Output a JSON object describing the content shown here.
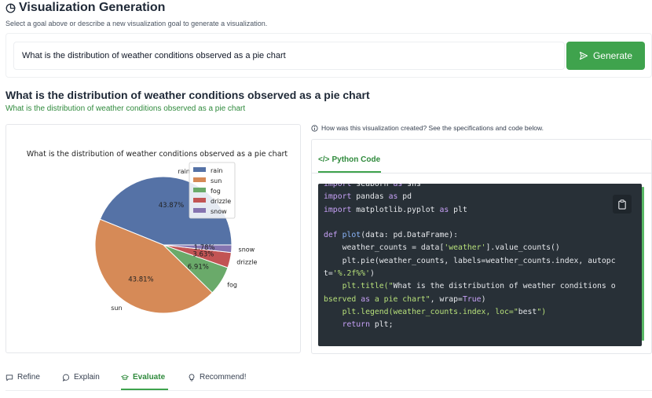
{
  "header": {
    "title": "Visualization Generation",
    "subtitle": "Select a goal above or describe a new visualization goal to generate a visualization."
  },
  "goal": {
    "input_value": "What is the distribution of weather conditions observed as a pie chart",
    "generate_label": "Generate"
  },
  "visualization": {
    "title": "What is the distribution of weather conditions observed as a pie chart",
    "subtitle": "What is the distribution of weather conditions observed as a pie chart",
    "info_text": "How was this visualization created? See the specifications and code below."
  },
  "code_panel": {
    "tab_label": "Python Code",
    "lines": [
      "import seaborn as sns",
      "import pandas as pd",
      "import matplotlib.pyplot as plt",
      "",
      "def plot(data: pd.DataFrame):",
      "    weather_counts = data['weather'].value_counts()",
      "    plt.pie(weather_counts, labels=weather_counts.index, autopc",
      "t='%.2f%%')",
      "    plt.title(\"What is the distribution of weather conditions o",
      "bserved as a pie chart\", wrap=True)",
      "    plt.legend(weather_counts.index, loc=\"best\")",
      "    return plt;"
    ]
  },
  "bottom_tabs": [
    {
      "label": "Refine",
      "icon": "chat-icon",
      "active": false
    },
    {
      "label": "Explain",
      "icon": "speech-bubble-icon",
      "active": false
    },
    {
      "label": "Evaluate",
      "icon": "graduation-cap-icon",
      "active": true
    },
    {
      "label": "Recommend!",
      "icon": "lightbulb-icon",
      "active": false
    }
  ],
  "colors": {
    "accent_green": "#3fa34d",
    "code_bg": "#283037"
  },
  "chart_data": {
    "type": "pie",
    "title": "What is the distribution of weather conditions observed as a pie chart",
    "categories": [
      "rain",
      "sun",
      "fog",
      "drizzle",
      "snow"
    ],
    "values": [
      43.87,
      43.81,
      6.91,
      3.63,
      1.78
    ],
    "value_labels": [
      "43.87%",
      "43.81%",
      "6.91%",
      "3.63%",
      "1.78%"
    ],
    "colors": [
      "#5572a6",
      "#d68a57",
      "#6aaa6a",
      "#c25454",
      "#8574b0"
    ],
    "legend": [
      "rain",
      "sun",
      "fog",
      "drizzle",
      "snow"
    ],
    "legend_placement": "top-right"
  }
}
